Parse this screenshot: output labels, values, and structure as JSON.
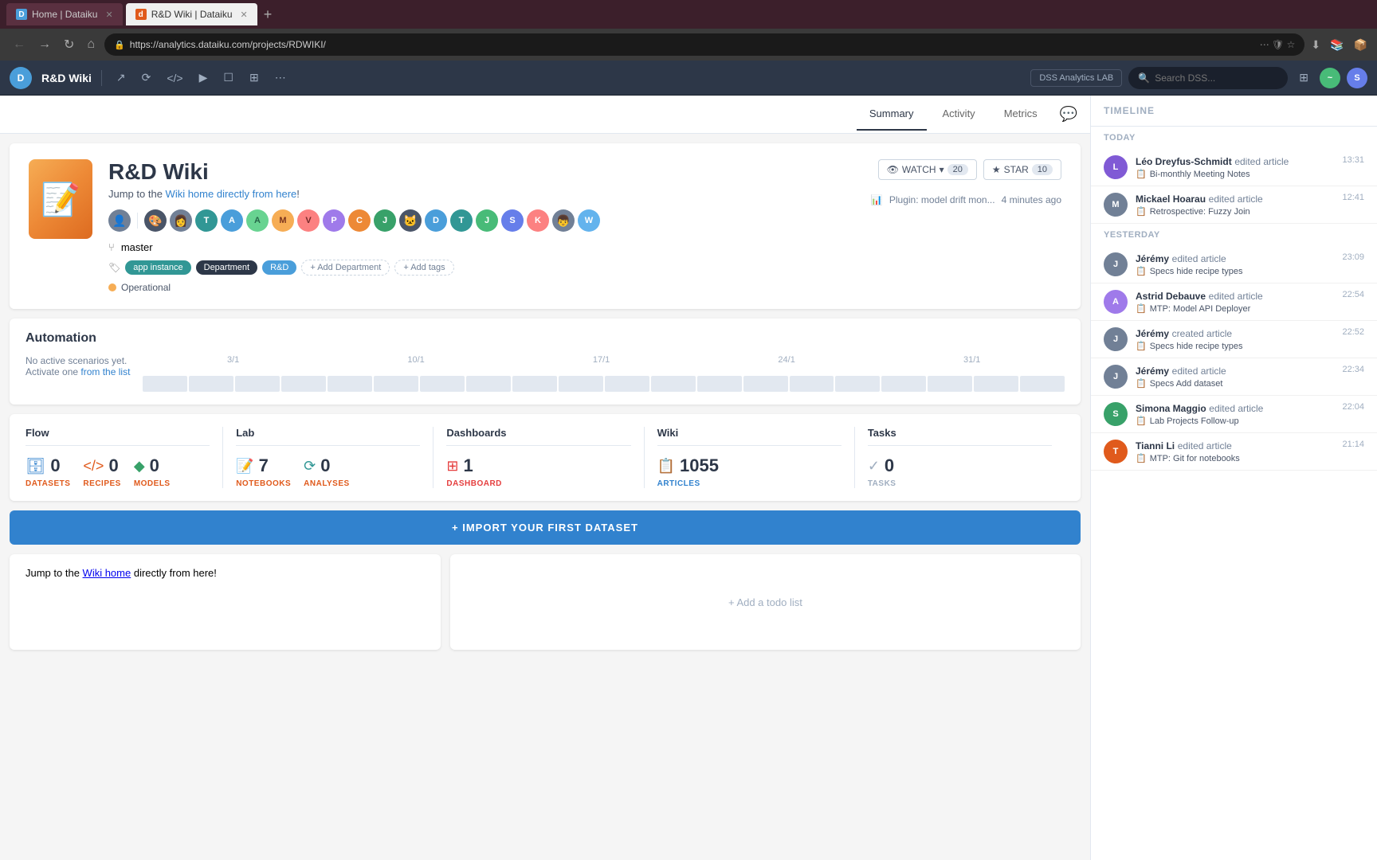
{
  "browser": {
    "tabs": [
      {
        "id": "home",
        "label": "Home | Dataiku",
        "favicon_type": "home",
        "favicon_text": "D",
        "active": false
      },
      {
        "id": "wiki",
        "label": "R&D Wiki | Dataiku",
        "favicon_type": "wiki",
        "favicon_text": "d",
        "active": true
      }
    ],
    "url": "https://analytics.dataiku.com/projects/RDWIKI/",
    "new_tab_icon": "+"
  },
  "toolbar": {
    "app_title": "R&D Wiki",
    "lab_label": "DSS Analytics LAB",
    "search_placeholder": "Search DSS...",
    "watch_label": "WATCH",
    "watch_count": "20",
    "star_label": "STAR",
    "star_count": "10"
  },
  "tabs": {
    "items": [
      {
        "id": "summary",
        "label": "Summary",
        "active": true
      },
      {
        "id": "activity",
        "label": "Activity",
        "active": false
      },
      {
        "id": "metrics",
        "label": "Metrics",
        "active": false
      }
    ]
  },
  "project": {
    "title": "R&D Wiki",
    "subtitle_before": "Jump to the ",
    "subtitle_link_text": "Wiki home",
    "subtitle_between": " ",
    "subtitle_link2": "directly from here",
    "subtitle_after": "!",
    "branch": "master",
    "tags": [
      "app instance",
      "Department",
      "R&D"
    ],
    "add_department": "+ Add Department",
    "add_tags": "+ Add tags",
    "status": "Operational",
    "plugin_text": "Plugin: model drift mon...",
    "plugin_time": "4 minutes ago"
  },
  "automation": {
    "title": "Automation",
    "empty_text": "No active scenarios yet.",
    "empty_link_text": "Activate one",
    "empty_link_label": "from the list",
    "timeline_labels": [
      "3/1",
      "10/1",
      "17/1",
      "24/1",
      "31/1"
    ]
  },
  "stats": {
    "flow": {
      "title": "Flow",
      "datasets": {
        "value": "0",
        "label": "DATASETS"
      },
      "recipes": {
        "value": "0",
        "label": "RECIPES"
      },
      "models": {
        "value": "0",
        "label": "MODELS"
      }
    },
    "lab": {
      "title": "Lab",
      "notebooks": {
        "value": "7",
        "label": "NOTEBOOKS"
      },
      "analyses": {
        "value": "0",
        "label": "ANALYSES"
      }
    },
    "dashboards": {
      "title": "Dashboards",
      "dashboard": {
        "value": "1",
        "label": "DASHBOARD"
      }
    },
    "wiki": {
      "title": "Wiki",
      "articles": {
        "value": "1055",
        "label": "ARTICLES"
      }
    },
    "tasks": {
      "title": "Tasks",
      "tasks": {
        "value": "0",
        "label": "TASKS"
      }
    }
  },
  "import_btn": "+ IMPORT YOUR FIRST DATASET",
  "wiki_card": {
    "subtitle_before": "Jump to the ",
    "link_text": "Wiki home",
    "subtitle_after": " directly from here!"
  },
  "todo_card": {
    "add_label": "+ Add a todo list"
  },
  "timeline": {
    "header": "TIMELINE",
    "today_label": "TODAY",
    "yesterday_label": "YESTERDAY",
    "items_today": [
      {
        "user": "Léo Dreyfus-Schmidt",
        "action": " edited article",
        "article": "Bi-monthly Meeting Notes",
        "time": "13:31",
        "avatar_bg": "#805ad5",
        "avatar_text": "L"
      },
      {
        "user": "Mickael Hoarau",
        "action": " edited article",
        "article": "Retrospective: Fuzzy Join",
        "time": "12:41",
        "avatar_bg": "#718096",
        "avatar_text": "M",
        "avatar_img": true
      }
    ],
    "items_yesterday": [
      {
        "user": "Jérémy",
        "action": " edited article",
        "article": "Specs hide recipe types",
        "time": "23:09",
        "avatar_bg": "#718096",
        "avatar_text": "J",
        "avatar_img": true
      },
      {
        "user": "Astrid Debauve",
        "action": " edited article",
        "article": "MTP: Model API Deployer",
        "time": "22:54",
        "avatar_bg": "#9f7aea",
        "avatar_text": "A",
        "avatar_img": true
      },
      {
        "user": "Jérémy",
        "action": " created article",
        "article": "Specs hide recipe types",
        "time": "22:52",
        "avatar_bg": "#718096",
        "avatar_text": "J",
        "avatar_img": true
      },
      {
        "user": "Jérémy",
        "action": " edited article",
        "article": "Specs Add dataset",
        "time": "22:34",
        "avatar_bg": "#718096",
        "avatar_text": "J",
        "avatar_img": true
      },
      {
        "user": "Simona Maggio",
        "action": " edited article",
        "article": "Lab Projects Follow-up",
        "time": "22:04",
        "avatar_bg": "#38a169",
        "avatar_text": "S"
      },
      {
        "user": "Tianni Li",
        "action": " edited article",
        "article": "MTP: Git for notebooks",
        "time": "21:14",
        "avatar_bg": "#e05a1c",
        "avatar_text": "T"
      }
    ]
  },
  "avatars": [
    {
      "text": "👤",
      "bg": "#718096"
    },
    {
      "text": "🎨",
      "bg": "#4a5568"
    },
    {
      "text": "👩",
      "bg": "#718096"
    },
    {
      "text": "T",
      "bg": "#319795"
    },
    {
      "text": "A",
      "bg": "#4a9eda"
    },
    {
      "text": "A",
      "bg": "#68d391"
    },
    {
      "text": "M",
      "bg": "#f6ad55"
    },
    {
      "text": "V",
      "bg": "#fc8181"
    },
    {
      "text": "P",
      "bg": "#9f7aea"
    },
    {
      "text": "C",
      "bg": "#ed8936"
    },
    {
      "text": "J",
      "bg": "#38a169"
    },
    {
      "text": "🐱",
      "bg": "#4a5568"
    },
    {
      "text": "D",
      "bg": "#4a9eda"
    },
    {
      "text": "T",
      "bg": "#319795"
    },
    {
      "text": "J",
      "bg": "#48bb78"
    },
    {
      "text": "S",
      "bg": "#667eea"
    },
    {
      "text": "K",
      "bg": "#fc8181"
    },
    {
      "text": "👦",
      "bg": "#718096"
    },
    {
      "text": "W",
      "bg": "#63b3ed"
    }
  ]
}
